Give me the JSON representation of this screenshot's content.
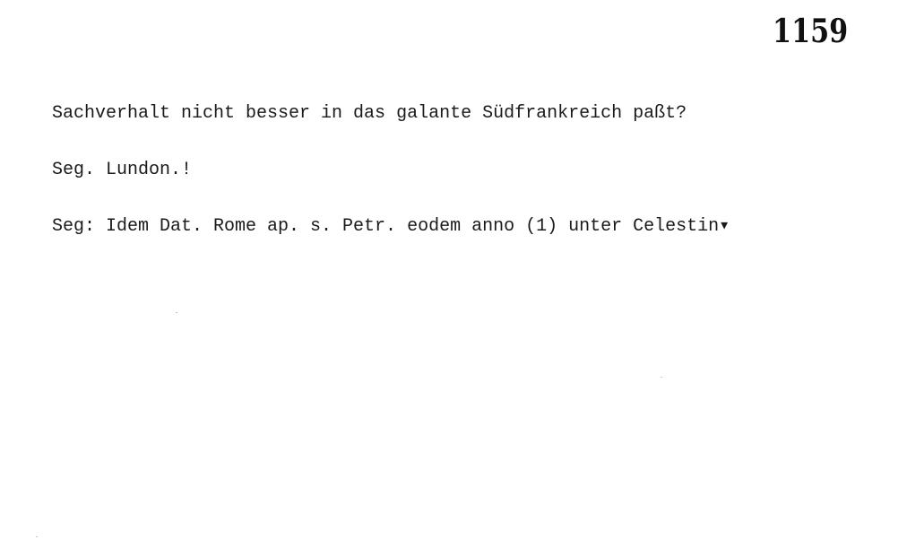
{
  "card": {
    "number": "1159",
    "lines": [
      "Sachverhalt nicht besser in das galante Südfrankreich paßt?",
      "Seg. Lundon.!",
      "Seg: Idem Dat. Rome ap. s. Petr. eodem anno (1) unter Celestin▾"
    ]
  }
}
